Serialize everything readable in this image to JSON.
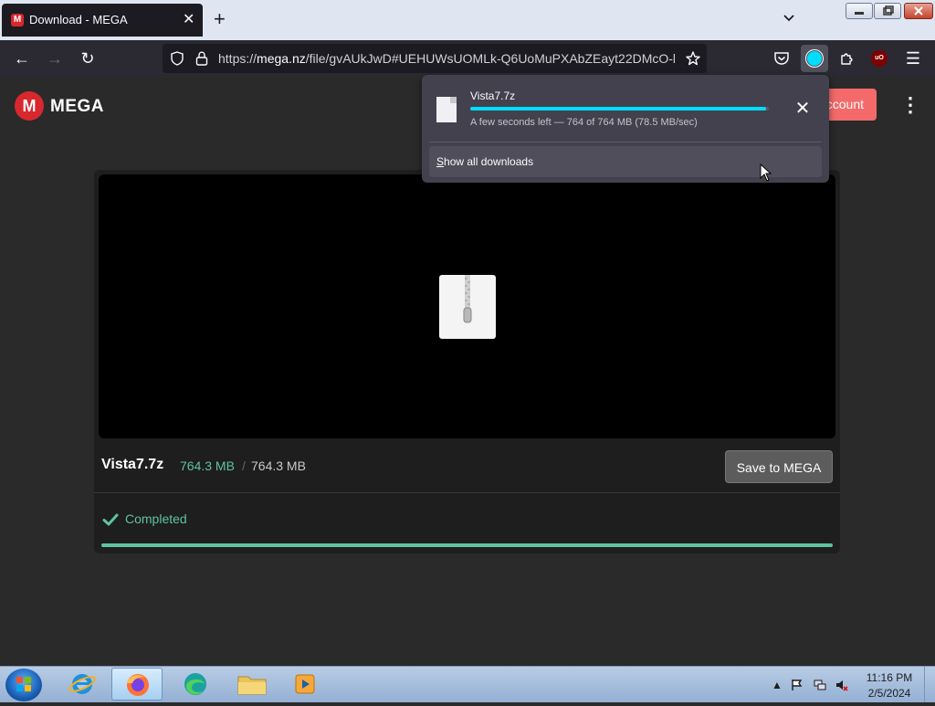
{
  "window": {
    "tab_title": "Download - MEGA",
    "tab_close": "✕",
    "new_tab": "+",
    "minimize": "▭",
    "restore": "❐",
    "close": "✕"
  },
  "toolbar": {
    "back": "←",
    "forward": "→",
    "reload": "↻",
    "url_prefix": "https://",
    "url_host": "mega.nz",
    "url_rest": "/file/gvAUkJwD#UEHUWsUOMLk-Q6UoMuPXAbZEayt22DMcO-h",
    "menu": "☰"
  },
  "page": {
    "logo_letter": "M",
    "logo_text": "MEGA",
    "account_label": "ccount",
    "kebab": "⋮",
    "file_name": "Vista7.7z",
    "size_done": "764.3 MB",
    "size_sep": "/",
    "size_total": "764.3 MB",
    "save_label": "Save to MEGA",
    "status": "Completed",
    "progress": 1.0,
    "accent": "#5fc2a3"
  },
  "downloads": {
    "file_name": "Vista7.7z",
    "status": "A few seconds left — 764 of 764 MB (78.5 MB/sec)",
    "progress": 0.99,
    "close": "✕",
    "show_all_first": "S",
    "show_all_rest": "how all downloads"
  },
  "taskbar": {
    "time": "11:16 PM",
    "date": "2/5/2024"
  }
}
